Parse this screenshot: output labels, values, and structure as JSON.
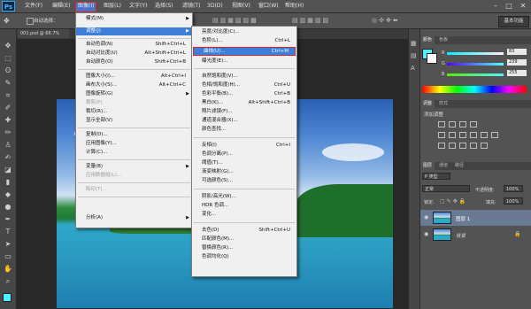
{
  "app": {
    "logo": "Ps",
    "workspace": "基本功能",
    "doc_tab": "001.psd @ 66.7%"
  },
  "menubar": [
    {
      "id": "file",
      "label": "文件(F)"
    },
    {
      "id": "edit",
      "label": "编辑(E)"
    },
    {
      "id": "image",
      "label": "图像(I)"
    },
    {
      "id": "layer",
      "label": "图层(L)"
    },
    {
      "id": "type",
      "label": "文字(Y)"
    },
    {
      "id": "select",
      "label": "选择(S)"
    },
    {
      "id": "filter",
      "label": "滤镜(T)"
    },
    {
      "id": "3d",
      "label": "3D(D)"
    },
    {
      "id": "view",
      "label": "视图(V)"
    },
    {
      "id": "window",
      "label": "窗口(W)"
    },
    {
      "id": "help",
      "label": "帮助(H)"
    }
  ],
  "window_controls": {
    "minimize": "–",
    "maximize": "□",
    "close": "✕"
  },
  "options_bar": {
    "auto_select_label": "自动选择："
  },
  "image_menu": [
    {
      "label": "模式(M)",
      "shortcut": "",
      "submenu": true,
      "disabled": false
    },
    {
      "label": "调整(J)",
      "shortcut": "",
      "submenu": true,
      "disabled": false
    },
    {
      "label": "自动色调(N)",
      "shortcut": "Shift+Ctrl+L",
      "submenu": false,
      "disabled": false
    },
    {
      "label": "自动对比度(U)",
      "shortcut": "Alt+Shift+Ctrl+L",
      "submenu": false,
      "disabled": false
    },
    {
      "label": "自动颜色(O)",
      "shortcut": "Shift+Ctrl+B",
      "submenu": false,
      "disabled": false
    },
    {
      "label": "图像大小(I)...",
      "shortcut": "Alt+Ctrl+I",
      "submenu": false,
      "disabled": false
    },
    {
      "label": "画布大小(S)...",
      "shortcut": "Alt+Ctrl+C",
      "submenu": false,
      "disabled": false
    },
    {
      "label": "图像旋转(G)",
      "shortcut": "",
      "submenu": true,
      "disabled": false
    },
    {
      "label": "裁剪(P)",
      "shortcut": "",
      "submenu": false,
      "disabled": true
    },
    {
      "label": "裁切(R)...",
      "shortcut": "",
      "submenu": false,
      "disabled": false
    },
    {
      "label": "显示全部(V)",
      "shortcut": "",
      "submenu": false,
      "disabled": false
    },
    {
      "label": "复制(D)...",
      "shortcut": "",
      "submenu": false,
      "disabled": false
    },
    {
      "label": "应用图像(Y)...",
      "shortcut": "",
      "submenu": false,
      "disabled": false
    },
    {
      "label": "计算(C)...",
      "shortcut": "",
      "submenu": false,
      "disabled": false
    },
    {
      "label": "变量(B)",
      "shortcut": "",
      "submenu": true,
      "disabled": false
    },
    {
      "label": "应用数据组(L)...",
      "shortcut": "",
      "submenu": false,
      "disabled": true
    },
    {
      "label": "陷印(T)...",
      "shortcut": "",
      "submenu": false,
      "disabled": true
    },
    {
      "label": "分析(A)",
      "shortcut": "",
      "submenu": true,
      "disabled": false
    }
  ],
  "adjust_menu": [
    {
      "label": "亮度/对比度(C)...",
      "shortcut": ""
    },
    {
      "label": "色阶(L)...",
      "shortcut": "Ctrl+L"
    },
    {
      "label": "曲线(U)...",
      "shortcut": "Ctrl+M"
    },
    {
      "label": "曝光度(E)...",
      "shortcut": ""
    },
    {
      "label": "自然饱和度(V)...",
      "shortcut": ""
    },
    {
      "label": "色相/饱和度(H)...",
      "shortcut": "Ctrl+U"
    },
    {
      "label": "色彩平衡(B)...",
      "shortcut": "Ctrl+B"
    },
    {
      "label": "黑白(K)...",
      "shortcut": "Alt+Shift+Ctrl+B"
    },
    {
      "label": "照片滤镜(F)...",
      "shortcut": ""
    },
    {
      "label": "通道混合器(X)...",
      "shortcut": ""
    },
    {
      "label": "颜色查找...",
      "shortcut": ""
    },
    {
      "label": "反相(I)",
      "shortcut": "Ctrl+I"
    },
    {
      "label": "色调分离(P)...",
      "shortcut": ""
    },
    {
      "label": "阈值(T)...",
      "shortcut": ""
    },
    {
      "label": "渐变映射(G)...",
      "shortcut": ""
    },
    {
      "label": "可选颜色(S)...",
      "shortcut": ""
    },
    {
      "label": "阴影/高光(W)...",
      "shortcut": ""
    },
    {
      "label": "HDR 色调...",
      "shortcut": ""
    },
    {
      "label": "变化...",
      "shortcut": ""
    },
    {
      "label": "去色(D)",
      "shortcut": "Shift+Ctrl+U"
    },
    {
      "label": "匹配颜色(M)...",
      "shortcut": ""
    },
    {
      "label": "替换颜色(R)...",
      "shortcut": ""
    },
    {
      "label": "色调均化(Q)",
      "shortcut": ""
    }
  ],
  "color_panel": {
    "tabs": [
      "颜色",
      "色板"
    ],
    "channels": [
      {
        "label": "R",
        "value": "83"
      },
      {
        "label": "G",
        "value": "239"
      },
      {
        "label": "B",
        "value": "255"
      }
    ],
    "foreground": "#53efff",
    "background": "#ffffff"
  },
  "adjustments_panel": {
    "tabs": [
      "调整",
      "样式"
    ],
    "title": "添加调整"
  },
  "layers_panel": {
    "tabs": [
      "图层",
      "通道",
      "路径"
    ],
    "kind_label": "P 类型",
    "blend_mode": "正常",
    "opacity_label": "不透明度:",
    "opacity_value": "100%",
    "lock_label": "锁定:",
    "fill_label": "填充:",
    "fill_value": "100%",
    "layers": [
      {
        "name": "图层 1",
        "selected": true
      },
      {
        "name": "背景",
        "selected": false
      }
    ]
  }
}
